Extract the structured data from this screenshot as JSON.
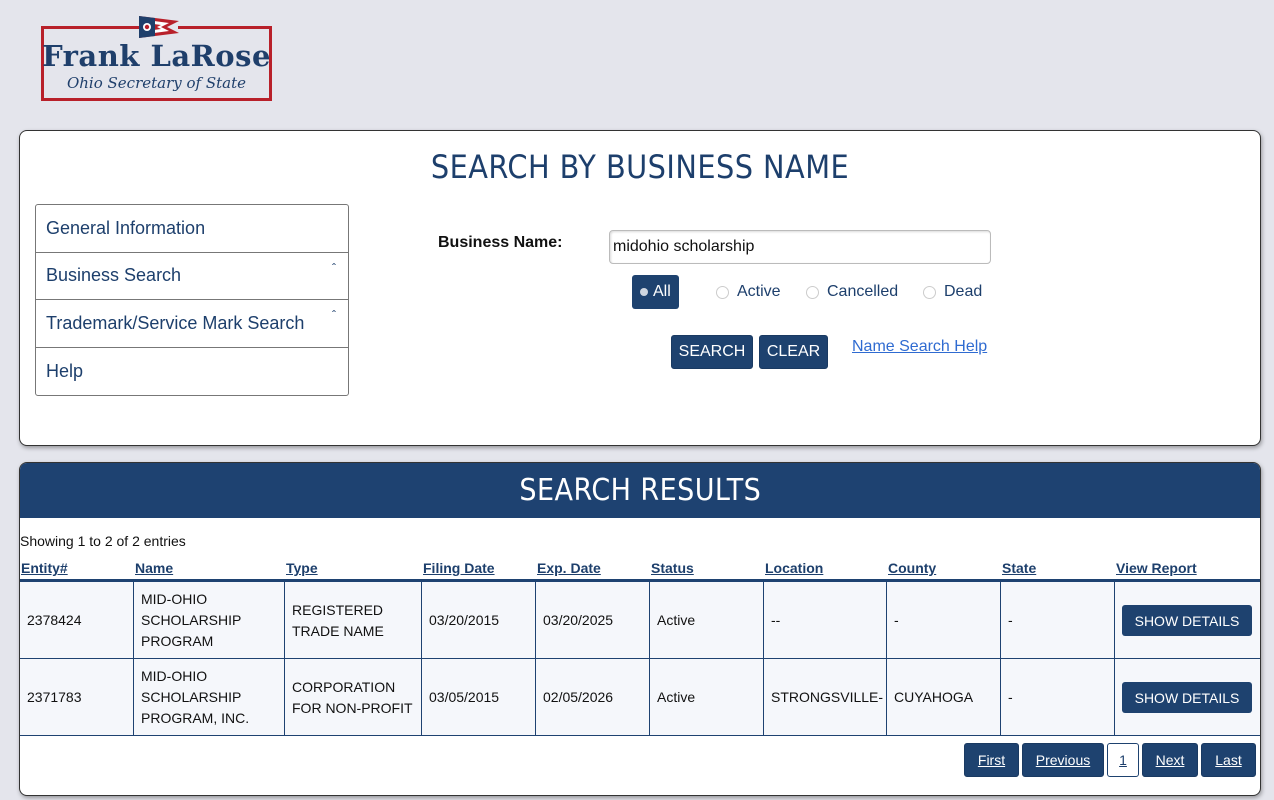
{
  "logo": {
    "name": "Frank LaRose",
    "subtitle": "Ohio Secretary of State"
  },
  "search": {
    "title": "SEARCH BY BUSINESS NAME",
    "label": "Business Name:",
    "value": "midohio scholarship",
    "filters": [
      "All",
      "Active",
      "Cancelled",
      "Dead"
    ],
    "selected_filter": "All",
    "search_label": "SEARCH",
    "clear_label": "CLEAR",
    "help_link": "Name Search Help"
  },
  "nav": {
    "items": [
      {
        "label": "General Information"
      },
      {
        "label": "Business Search"
      },
      {
        "label": "Trademark/Service Mark Search"
      },
      {
        "label": "Help"
      }
    ]
  },
  "results": {
    "title": "SEARCH RESULTS",
    "showing": "Showing 1 to 2 of 2 entries",
    "columns": [
      "Entity#",
      "Name",
      "Type",
      "Filing Date",
      "Exp. Date",
      "Status",
      "Location",
      "County",
      "State",
      "View Report"
    ],
    "rows": [
      {
        "entity": "2378424",
        "name": [
          "MID-OHIO",
          "SCHOLARSHIP",
          "PROGRAM"
        ],
        "type": [
          "REGISTERED",
          "TRADE NAME"
        ],
        "filing_date": "03/20/2015",
        "exp_date": "03/20/2025",
        "status": "Active",
        "location": "--",
        "county": "-",
        "state": "-",
        "action": "SHOW DETAILS"
      },
      {
        "entity": "2371783",
        "name": [
          "MID-OHIO",
          "SCHOLARSHIP",
          "PROGRAM, INC."
        ],
        "type": [
          "CORPORATION",
          "FOR NON-PROFIT"
        ],
        "filing_date": "03/05/2015",
        "exp_date": "02/05/2026",
        "status": "Active",
        "location": "STRONGSVILLE-",
        "county": "CUYAHOGA",
        "state": "-",
        "action": "SHOW DETAILS"
      }
    ],
    "pagination": {
      "first": "First",
      "previous": "Previous",
      "current": "1",
      "next": "Next",
      "last": "Last"
    }
  },
  "colors": {
    "navy": "#1e426f",
    "link_blue": "#2f6bd1",
    "logo_red": "#b8202a",
    "page_bg": "#e4e5ec"
  }
}
